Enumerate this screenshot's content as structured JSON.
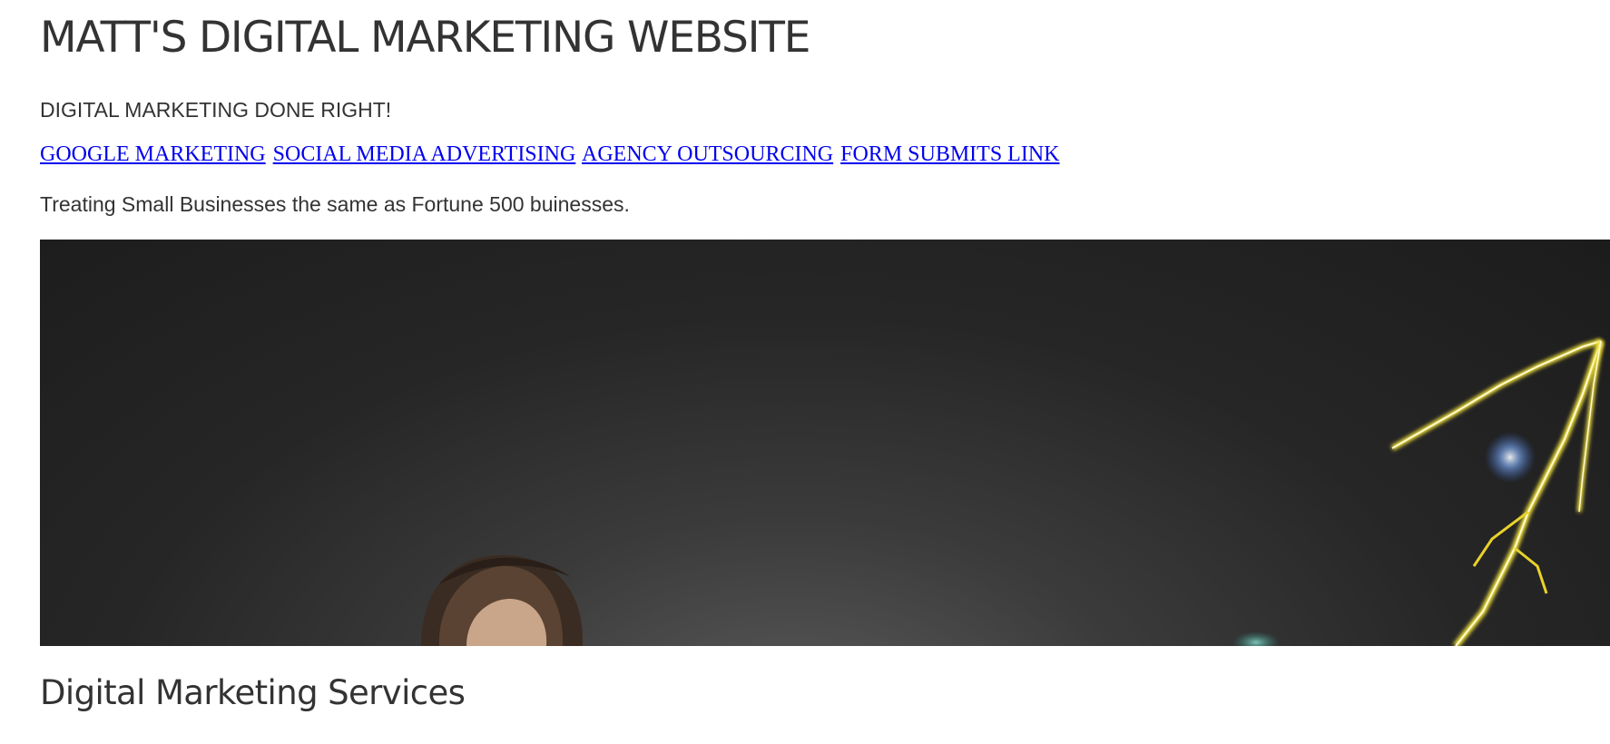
{
  "site": {
    "title": "MATT'S DIGITAL MARKETING WEBSITE",
    "tagline": "DIGITAL MARKETING DONE RIGHT!",
    "intro": "Treating Small Businesses the same as Fortune 500 buinesses."
  },
  "nav": {
    "links": [
      {
        "label": "GOOGLE MARKETING"
      },
      {
        "label": "SOCIAL MEDIA ADVERTISING"
      },
      {
        "label": "AGENCY OUTSOURCING"
      },
      {
        "label": "FORM SUBMITS LINK"
      }
    ]
  },
  "main": {
    "section_heading": "Digital Marketing Services"
  },
  "colors": {
    "text": "#333333",
    "link": "#0000ee",
    "hero_background": "#262626",
    "lightning": "#f3e23a"
  }
}
